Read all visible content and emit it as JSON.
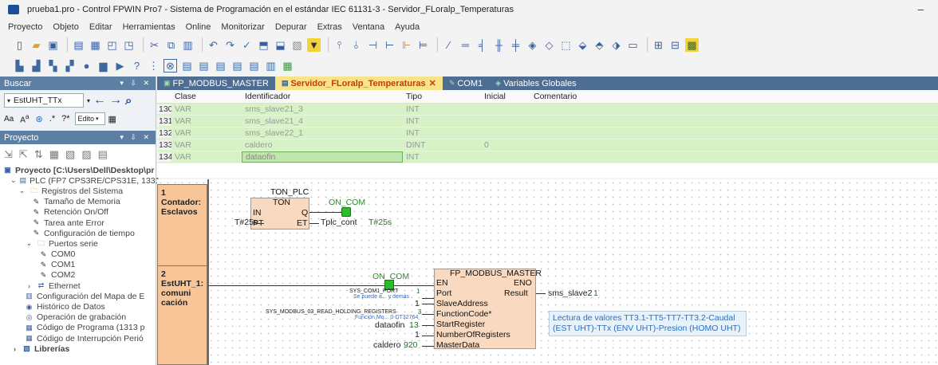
{
  "window": {
    "title": "prueba1.pro - Control FPWIN Pro7 - Sistema de Programación en el estándar IEC 61131-3 - Servidor_FLoralp_Temperaturas",
    "minimize": "–"
  },
  "menu": [
    "Proyecto",
    "Objeto",
    "Editar",
    "Herramientas",
    "Online",
    "Monitorizar",
    "Depurar",
    "Extras",
    "Ventana",
    "Ayuda"
  ],
  "buscar": {
    "title": "Buscar",
    "controls": "▾ ⇩ ✕",
    "value": "EstUHT_TTx",
    "edit_label": "Edito"
  },
  "proyecto": {
    "title": "Proyecto",
    "controls": "▾ ⇩ ✕",
    "tree": [
      {
        "label": "Proyecto [C:\\Users\\Dell\\Desktop\\pr",
        "indent": 0,
        "icon": "project-icon",
        "bold": true
      },
      {
        "label": "PLC (FP7 CPS3RE/CPS31E, 1331",
        "indent": 1,
        "icon": "plc-icon",
        "bold": false
      },
      {
        "label": "Registros del Sistema",
        "indent": 2,
        "icon": "folder-wrench-icon",
        "bold": false
      },
      {
        "label": "Tamaño de Memoria",
        "indent": 4,
        "icon": "wrench-icon"
      },
      {
        "label": "Retención On/Off",
        "indent": 4,
        "icon": "wrench-icon"
      },
      {
        "label": "Tarea ante Error",
        "indent": 4,
        "icon": "wrench-icon"
      },
      {
        "label": "Configuración de tiempo",
        "indent": 4,
        "icon": "wrench-icon"
      },
      {
        "label": "Puertos serie",
        "indent": 3,
        "icon": "folder-wrench-icon"
      },
      {
        "label": "COM0",
        "indent": 5,
        "icon": "wrench-icon"
      },
      {
        "label": "COM1",
        "indent": 5,
        "icon": "wrench-icon"
      },
      {
        "label": "COM2",
        "indent": 5,
        "icon": "wrench-icon"
      },
      {
        "label": "Ethernet",
        "indent": 3,
        "icon": "network-icon"
      },
      {
        "label": "Configuración del Mapa de E",
        "indent": 3,
        "icon": "map-icon"
      },
      {
        "label": "Histórico de Datos",
        "indent": 3,
        "icon": "history-icon"
      },
      {
        "label": "Operación de grabación",
        "indent": 3,
        "icon": "record-icon"
      },
      {
        "label": "Código de Programa (1313 p",
        "indent": 3,
        "icon": "code-icon"
      },
      {
        "label": "Código de Interrupción Perió",
        "indent": 3,
        "icon": "code-icon"
      },
      {
        "label": "Librerías",
        "indent": 1,
        "icon": "library-icon",
        "bold": true
      }
    ]
  },
  "tabs": [
    {
      "label": "FP_MODBUS_MASTER",
      "active": false,
      "icon": "fb-icon"
    },
    {
      "label": "Servidor_FLoralp_Temperaturas",
      "active": true,
      "icon": "ld-icon",
      "close": "✕"
    },
    {
      "label": "COM1",
      "active": false,
      "icon": "wrench-icon"
    },
    {
      "label": "Variables Globales",
      "active": false,
      "icon": "globe-icon"
    }
  ],
  "grid": {
    "headers": [
      "",
      "Clase",
      "Identificador",
      "Tipo",
      "Inicial",
      "Comentario"
    ],
    "rows": [
      [
        "130",
        "VAR",
        "sms_slave21_3",
        "INT",
        "",
        ""
      ],
      [
        "131",
        "VAR",
        "sms_slave21_4",
        "INT",
        "",
        ""
      ],
      [
        "132",
        "VAR",
        "sms_slave22_1",
        "INT",
        "",
        ""
      ],
      [
        "133",
        "VAR",
        "caldero",
        "DINT",
        "0",
        ""
      ],
      [
        "134",
        "VAR",
        "dataofin",
        "INT",
        "",
        ""
      ]
    ]
  },
  "ladder": {
    "rung1": {
      "num": "1",
      "label1": "Contador:",
      "label2": "Esclavos",
      "fb_instance": "TON_PLC",
      "fb_type": "TON",
      "pin_in": "IN",
      "pin_q": "Q",
      "pin_pt": "PT",
      "pin_et": "ET",
      "input_pt": "T#25s",
      "output_var": "ON_COM",
      "et_out": "Tplc_cont",
      "et_val": "T#25s"
    },
    "rung2": {
      "num": "2",
      "label1": "EstUHT_1:",
      "label2": "comuni",
      "label3": "cación",
      "contact": "ON_COM",
      "fb_type": "FP_MODBUS_MASTER",
      "pins_left": [
        "EN",
        "Port",
        "SlaveAddress",
        "FunctionCode*",
        "StartRegister",
        "NumberOfRegisters",
        "MasterData"
      ],
      "pin_eno": "ENO",
      "pin_result": "Result",
      "result_var": "sms_slave2",
      "result_val": "1",
      "in_port_const": "SYS_COM1_PORT",
      "in_port_val": "1",
      "in_port_tip": "Se puede a... y demás",
      "in_slave": "1",
      "in_func_const": "SYS_MODBUS_03_READ_HOLDING_REGISTERS",
      "in_func_val": "3",
      "in_func_tip": "Función Mo... 0-DT32764",
      "in_start_var": "dataofin",
      "in_start_val": "13",
      "in_num": "1",
      "in_master_var": "caldero",
      "in_master_val": "920",
      "comment1": "Lectura de valores TT3.1-TT5-TT7-TT3.2-Caudal",
      "comment2": "(EST UHT)-TTx (ENV UHT)-Presion (HOMO UHT)"
    }
  }
}
